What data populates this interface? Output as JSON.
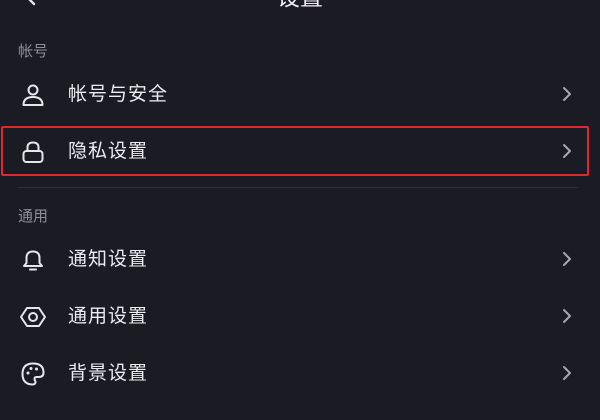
{
  "header": {
    "title": "设置",
    "back_icon": "chevron-left-icon"
  },
  "sections": [
    {
      "label": "帐号",
      "items": [
        {
          "label": "帐号与安全",
          "icon": "user-icon"
        },
        {
          "label": "隐私设置",
          "icon": "lock-icon",
          "highlighted": true
        }
      ]
    },
    {
      "label": "通用",
      "items": [
        {
          "label": "通知设置",
          "icon": "bell-icon"
        },
        {
          "label": "通用设置",
          "icon": "gear-icon"
        },
        {
          "label": "背景设置",
          "icon": "palette-icon"
        }
      ]
    }
  ],
  "colors": {
    "background": "#1b1b24",
    "text": "#ececf0",
    "section_label": "#8e8e98",
    "highlight_border": "#e0282a"
  }
}
